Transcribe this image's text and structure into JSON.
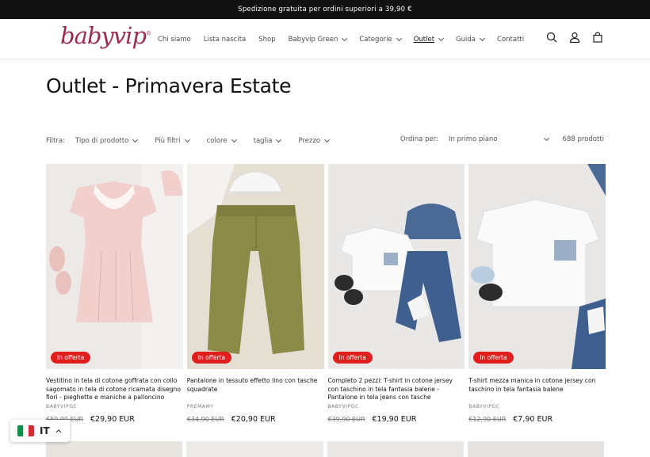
{
  "announcement": "Spedizione gratuita per ordini superiori a 39,90 €",
  "logo": {
    "text": "babyvip",
    "mark": "®"
  },
  "nav": [
    {
      "label": "Chi siamo",
      "dropdown": false,
      "active": false
    },
    {
      "label": "Lista nascita",
      "dropdown": false,
      "active": false
    },
    {
      "label": "Shop",
      "dropdown": false,
      "active": false
    },
    {
      "label": "Babyvip Green",
      "dropdown": true,
      "active": false
    },
    {
      "label": "Categorie",
      "dropdown": true,
      "active": false
    },
    {
      "label": "Outlet",
      "dropdown": true,
      "active": true
    },
    {
      "label": "Guida",
      "dropdown": true,
      "active": false
    },
    {
      "label": "Contatti",
      "dropdown": false,
      "active": false
    }
  ],
  "header_icons": [
    "search-icon",
    "account-icon",
    "cart-icon"
  ],
  "page_title": "Outlet - Primavera Estate",
  "filters": {
    "label": "Filtra:",
    "items": [
      "Tipo di prodotto",
      "Più filtri",
      "colore",
      "taglia",
      "Prezzo"
    ],
    "sort_label": "Ordina per:",
    "sort_value": "In primo piano",
    "count": "688 prodotti"
  },
  "products": [
    {
      "badge": "In offerta",
      "title": "Vestitino in tela di cotone goffrata con collo sagomato in tela di cotone ricamata disegno fiori - pieghette e maniche a palloncino",
      "vendor": "BABYVIPGC",
      "old_price": "€59,90 EUR",
      "price": "€29,90 EUR"
    },
    {
      "badge": "In offerta",
      "title": "Pantalone in tessuto effetto lino con tasche squadrate",
      "vendor": "PREMAMY",
      "old_price": "€34,90 EUR",
      "price": "€20,90 EUR"
    },
    {
      "badge": "In offerta",
      "title": "Completo 2 pezzi: T-shirt in cotone jersey con taschino in tela fantasia balene - Pantalone in tela jeans con tasche",
      "vendor": "BABYVIPGC",
      "old_price": "€39,90 EUR",
      "price": "€19,90 EUR"
    },
    {
      "badge": "In offerta",
      "title": "T-shirt mezza manica in cotone jersey con taschino in tela fantasia balene",
      "vendor": "BABYVIPGC",
      "old_price": "€12,90 EUR",
      "price": "€7,90 EUR"
    }
  ],
  "language": {
    "code": "IT",
    "flag_colors": [
      "#009246",
      "#ffffff",
      "#ce2b37"
    ]
  },
  "colors": {
    "brand": "#9a2b55",
    "sale_badge": "#e01e1e",
    "announcement_bg": "#121212"
  }
}
